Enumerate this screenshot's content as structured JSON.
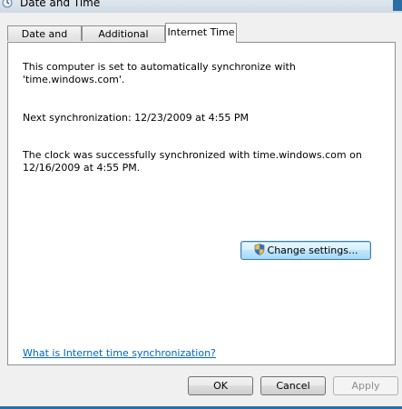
{
  "window": {
    "title": "Date and Time"
  },
  "tabs": [
    {
      "label": "Date and Time",
      "active": false
    },
    {
      "label": "Additional Clocks",
      "active": false
    },
    {
      "label": "Internet Time",
      "active": true
    }
  ],
  "internet_time": {
    "line1": "This computer is set to automatically synchronize with",
    "line2": "'time.windows.com'.",
    "next_sync": "Next synchronization: 12/23/2009 at 4:55 PM",
    "status_line1": "The clock was successfully synchronized with time.windows.com on",
    "status_line2": "12/16/2009 at 4:55 PM.",
    "change_settings_label": "Change settings...",
    "help_link": "What is Internet time synchronization?"
  },
  "footer": {
    "ok_label": "OK",
    "cancel_label": "Cancel",
    "apply_label": "Apply"
  },
  "colors": {
    "link": "#0066cc",
    "panel_bg": "#ffffff",
    "dialog_bg": "#f0f0f0",
    "accent": "#2b6ea6"
  },
  "icons": {
    "title": "clock-icon",
    "change_settings": "uac-shield-icon"
  }
}
